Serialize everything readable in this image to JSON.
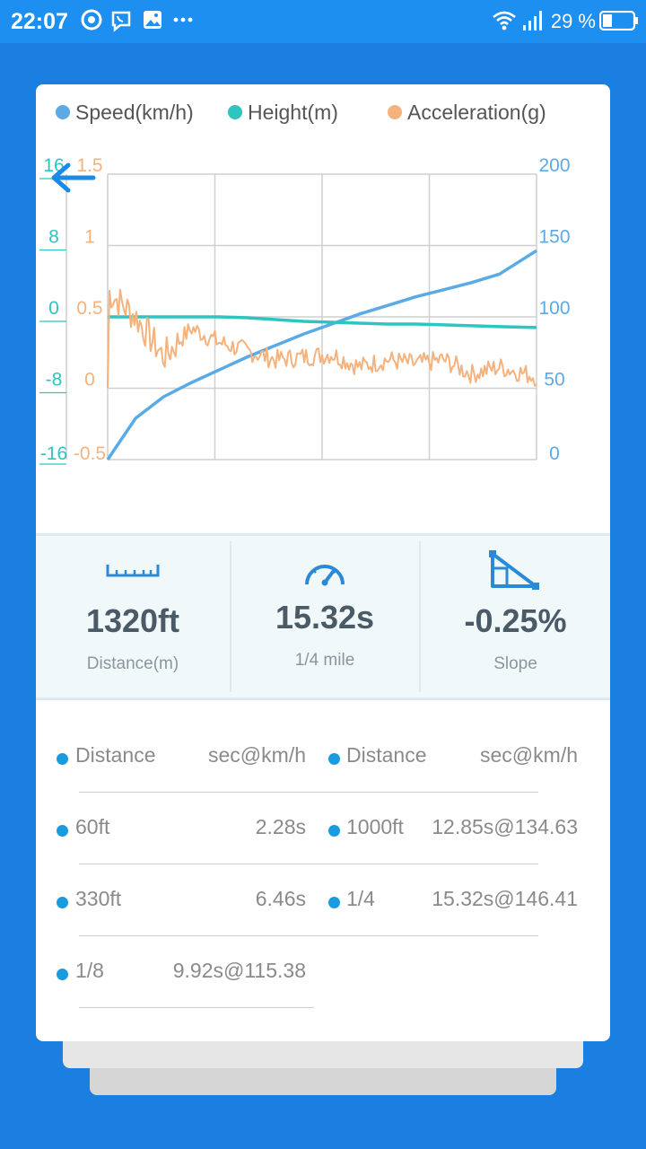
{
  "status_bar": {
    "time": "22:07",
    "battery": "29 %",
    "icons": [
      "chrome-icon",
      "viber-icon",
      "gallery-icon",
      "more-icon",
      "wifi-icon",
      "signal-icon",
      "battery-icon"
    ]
  },
  "header": {
    "back_icon": "arrow-left-icon"
  },
  "legend": [
    {
      "label": "Speed(km/h)",
      "color": "#5aaae6"
    },
    {
      "label": "Height(m)",
      "color": "#2ec4c0"
    },
    {
      "label": "Acceleration(g)",
      "color": "#f5b27c"
    }
  ],
  "chart_data": {
    "type": "line",
    "x": [
      0,
      1,
      2,
      3,
      4,
      5,
      6,
      7,
      8,
      9,
      10,
      11,
      12,
      13,
      14,
      15.32
    ],
    "series": [
      {
        "name": "Speed(km/h)",
        "axis": "right",
        "color": "#5aaae6",
        "values": [
          0,
          29,
          44,
          54,
          63,
          72,
          80,
          88,
          95,
          102,
          108,
          114,
          119,
          124,
          130,
          146.41
        ]
      },
      {
        "name": "Height(m)",
        "axis": "left-outer",
        "color": "#2ec4c0",
        "values": [
          0,
          0,
          0,
          0,
          0,
          -0.1,
          -0.3,
          -0.5,
          -0.6,
          -0.7,
          -0.8,
          -0.8,
          -0.9,
          -1.0,
          -1.1,
          -1.2
        ]
      },
      {
        "name": "Acceleration(g)",
        "axis": "left-inner",
        "color": "#f5b27c",
        "values": [
          0.68,
          0.5,
          0.22,
          0.42,
          0.32,
          0.26,
          0.2,
          0.22,
          0.24,
          0.15,
          0.2,
          0.17,
          0.2,
          0.1,
          0.15,
          0.08
        ]
      }
    ],
    "axes": {
      "left_outer": {
        "ticks": [
          "16",
          "8",
          "0",
          "-8",
          "-16"
        ],
        "range": [
          -16,
          16
        ],
        "color": "#2ec4c0"
      },
      "left_inner": {
        "ticks": [
          "1.5",
          "1",
          "0.5",
          "0",
          "-0.5"
        ],
        "range": [
          -0.5,
          1.5
        ],
        "color": "#f5b27c"
      },
      "right": {
        "ticks": [
          "200",
          "150",
          "100",
          "50",
          "0"
        ],
        "range": [
          0,
          200
        ],
        "color": "#5aaae6"
      }
    },
    "grid": true
  },
  "stats": [
    {
      "value": "1320ft",
      "label": "Distance(m)",
      "icon": "ruler-icon"
    },
    {
      "value": "15.32s",
      "label": "1/4 mile",
      "icon": "speedometer-icon"
    },
    {
      "value": "-0.25%",
      "label": "Slope",
      "icon": "slope-icon"
    }
  ],
  "splits": {
    "header": {
      "left_col": "Distance",
      "right_col": "sec@km/h"
    },
    "left": [
      {
        "distance": "60ft",
        "time": "2.28s"
      },
      {
        "distance": "330ft",
        "time": "6.46s"
      },
      {
        "distance": "1/8",
        "time": "9.92s@115.38"
      }
    ],
    "right": [
      {
        "distance": "1000ft",
        "time": "12.85s@134.63"
      },
      {
        "distance": "1/4",
        "time": "15.32s@146.41"
      }
    ]
  }
}
